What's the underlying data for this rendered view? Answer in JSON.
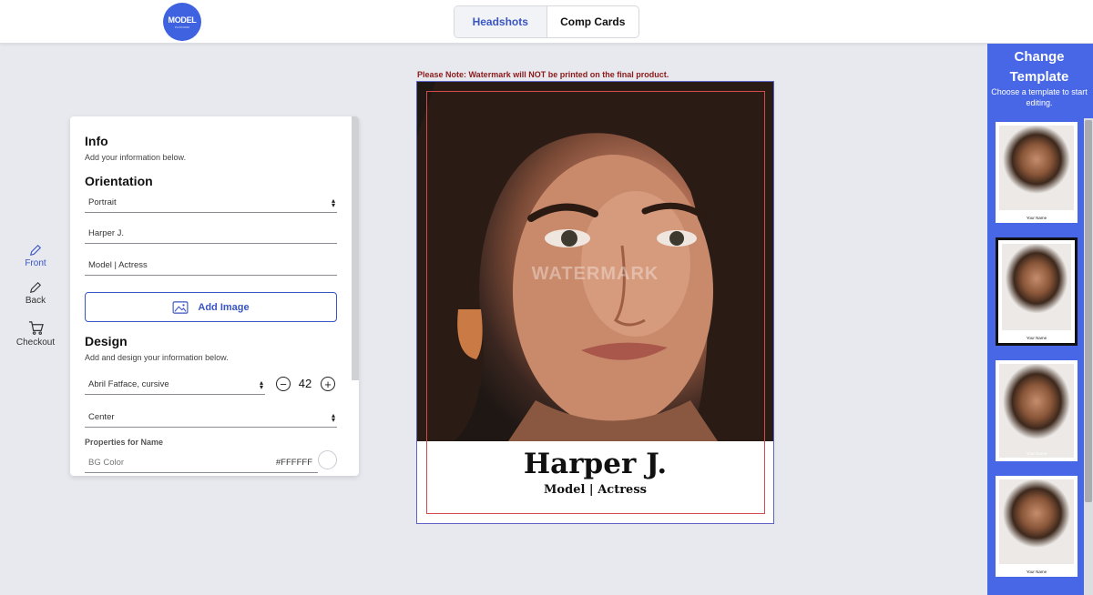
{
  "logo": {
    "line1": "MODEL",
    "line2": "PLATFORM"
  },
  "tabs": [
    {
      "label": "Headshots",
      "active": true
    },
    {
      "label": "Comp Cards",
      "active": false
    }
  ],
  "left_nav": [
    {
      "label": "Front",
      "icon": "pencil-icon",
      "active": true
    },
    {
      "label": "Back",
      "icon": "pencil-icon",
      "active": false
    },
    {
      "label": "Checkout",
      "icon": "cart-icon",
      "active": false
    }
  ],
  "form": {
    "info_heading": "Info",
    "info_sub": "Add your information below.",
    "orientation_heading": "Orientation",
    "orientation_value": "Portrait",
    "name_value": "Harper J.",
    "title_value": "Model | Actress",
    "add_image_label": "Add Image",
    "design_heading": "Design",
    "design_sub": "Add and design your information below.",
    "font_value": "Abril Fatface, cursive",
    "font_size": "42",
    "align_value": "Center",
    "properties_label": "Properties for Name",
    "bg_color_label": "BG Color",
    "bg_color_value": "#FFFFFF"
  },
  "canvas": {
    "note": "Please Note: Watermark will NOT be printed on the final product.",
    "watermark": "WATERMARK",
    "name": "Harper J.",
    "title": "Model | Actress"
  },
  "sidebar": {
    "title": "Change Template",
    "subtitle": "Choose a template to start editing.",
    "thumbnail_caption": "Your Name",
    "selected_index": 1
  },
  "colors": {
    "accent": "#3a55c4",
    "sidebar": "#4767e6",
    "note": "#8b1a1a",
    "safe_area": "#d34b4b"
  }
}
